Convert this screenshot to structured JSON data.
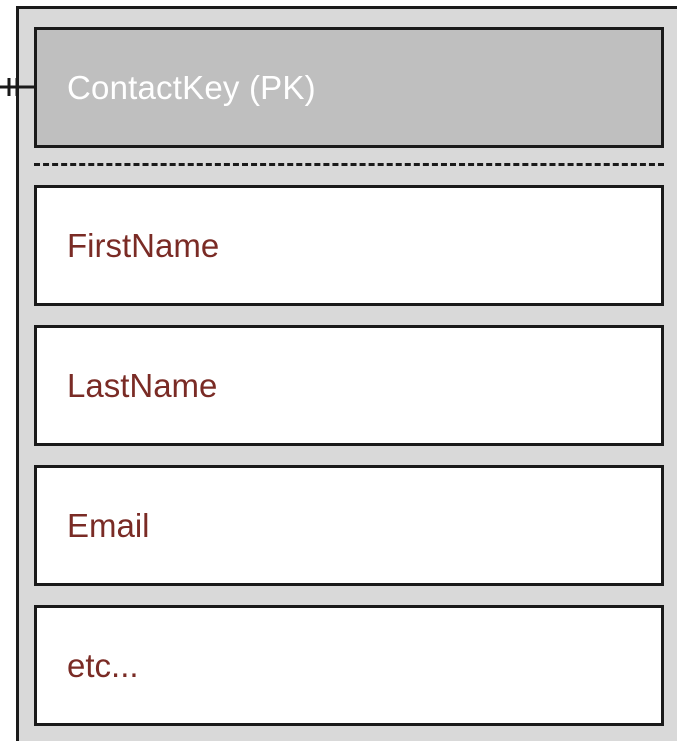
{
  "entity": {
    "primary_key": {
      "label": "ContactKey (PK)"
    },
    "fields": [
      {
        "label": "FirstName"
      },
      {
        "label": "LastName"
      },
      {
        "label": "Email"
      },
      {
        "label": "etc..."
      }
    ]
  },
  "colors": {
    "entity_background": "#d9d9d9",
    "pk_background": "#bfbfbf",
    "pk_text": "#ffffff",
    "field_text": "#7a2b25",
    "border": "#1a1a1a"
  },
  "icons": {
    "relationship_marker": "one-and-only-one-icon"
  }
}
